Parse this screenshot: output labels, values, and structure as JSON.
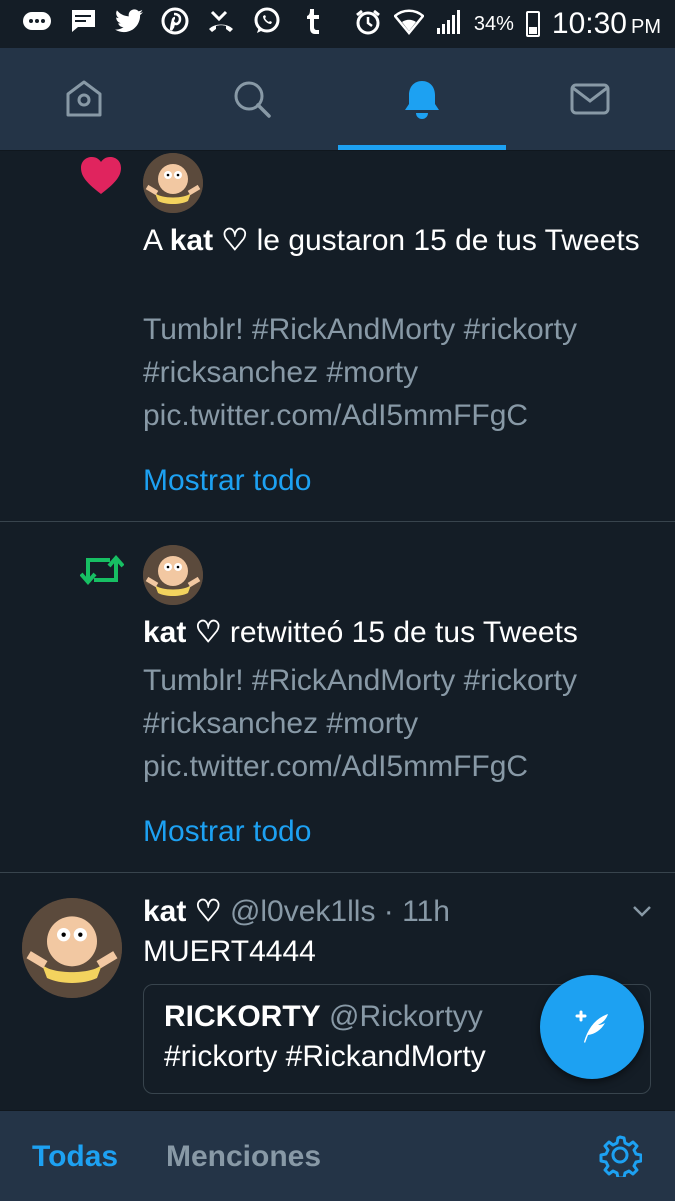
{
  "status_bar": {
    "battery": "34%",
    "time": "10:30",
    "ampm": "PM",
    "icons": [
      "messages-icon",
      "sms-icon",
      "twitter-icon",
      "pinterest-icon",
      "missed-call-icon",
      "whatsapp-icon",
      "tumblr-icon",
      "alarm-icon",
      "wifi-icon",
      "signal-icon",
      "battery-icon"
    ]
  },
  "top_tabs": [
    {
      "name": "home",
      "icon": "home-icon",
      "active": false
    },
    {
      "name": "search",
      "icon": "search-icon",
      "active": false
    },
    {
      "name": "notifications",
      "icon": "bell-icon",
      "active": true
    },
    {
      "name": "messages",
      "icon": "mail-icon",
      "active": false
    }
  ],
  "notifications": [
    {
      "type": "like",
      "icon": "heart-icon",
      "prefix": "A ",
      "user": "kat ♡",
      "action": " le gustaron 15 de tus Tweets",
      "tweet_text": "Tumblr! #RickAndMorty #rickorty #ricksanchez #morty pic.twitter.com/AdI5mmFFgC",
      "show_all": "Mostrar todo"
    },
    {
      "type": "retweet",
      "icon": "retweet-icon",
      "user": "kat ♡",
      "action": " retwitteó 15 de tus Tweets",
      "tweet_text": "Tumblr! #RickAndMorty #rickorty #ricksanchez #morty pic.twitter.com/AdI5mmFFgC",
      "show_all": "Mostrar todo"
    }
  ],
  "tweet": {
    "name": "kat ♡",
    "handle": "@l0vek1lls · 11h",
    "text": "MUERT4444",
    "quote": {
      "name": "RICKORTY",
      "handle": "@Rickortyy",
      "text": "#rickorty #RickandMorty"
    }
  },
  "bottom_tabs": {
    "all": "Todas",
    "mentions": "Menciones"
  },
  "colors": {
    "background": "#141d26",
    "bar": "#243447",
    "accent": "#1da1f2",
    "like": "#e0245e",
    "retweet": "#17bf63",
    "secondary_text": "#8899a6"
  }
}
